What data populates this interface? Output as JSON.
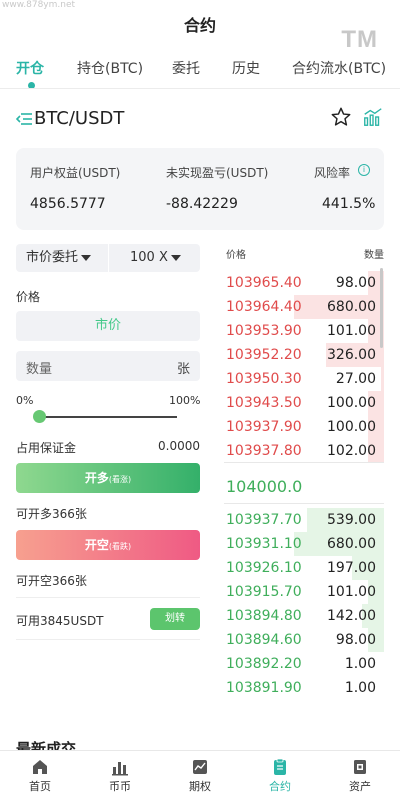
{
  "watermark": "www.878ym.net",
  "tm_mark": "TM",
  "header": {
    "title": "合约"
  },
  "tabs": [
    {
      "label": "开仓",
      "active": true
    },
    {
      "label": "持仓(BTC)"
    },
    {
      "label": "委托"
    },
    {
      "label": "历史"
    },
    {
      "label": "合约流水(BTC)"
    }
  ],
  "pair": {
    "name": "BTC/USDT",
    "icons": [
      "menu-fold-icon",
      "star-icon",
      "chart-icon"
    ]
  },
  "account": {
    "equity_label": "用户权益(USDT)",
    "equity_value": "4856.5777",
    "pnl_label": "未实现盈亏(USDT)",
    "pnl_value": "-88.42229",
    "risk_label": "风险率",
    "risk_value": "441.5%"
  },
  "order_form": {
    "order_type": "市价委托",
    "leverage": "100 X",
    "price_label": "价格",
    "market_text": "市价",
    "quantity_placeholder": "数量",
    "quantity_unit": "张",
    "percent_min": "0%",
    "percent_max": "100%",
    "slider_percent": 0,
    "margin_label": "占用保证金",
    "margin_value": "0.0000",
    "long_button": "开多",
    "long_button_sub": "(看涨)",
    "can_long": "可开多366张",
    "short_button": "开空",
    "short_button_sub": "(看跌)",
    "can_short": "可开空366张",
    "available": "可用3845USDT",
    "transfer_button": "划转"
  },
  "order_book": {
    "price_header": "价格",
    "qty_header": "数量",
    "asks": [
      {
        "price": "103965.40",
        "qty": "98.00",
        "depth": 0.1
      },
      {
        "price": "103964.40",
        "qty": "680.00",
        "depth": 0.56
      },
      {
        "price": "103953.90",
        "qty": "101.00",
        "depth": 0.1
      },
      {
        "price": "103952.20",
        "qty": "326.00",
        "depth": 0.36
      },
      {
        "price": "103950.30",
        "qty": "27.00",
        "depth": 0.02
      },
      {
        "price": "103943.50",
        "qty": "100.00",
        "depth": 0.1
      },
      {
        "price": "103937.90",
        "qty": "100.00",
        "depth": 0.1
      },
      {
        "price": "103937.80",
        "qty": "102.00",
        "depth": 0.1
      }
    ],
    "last_price": "104000.0",
    "bids": [
      {
        "price": "103937.70",
        "qty": "539.00",
        "depth": 0.48
      },
      {
        "price": "103931.10",
        "qty": "680.00",
        "depth": 0.56
      },
      {
        "price": "103926.10",
        "qty": "197.00",
        "depth": 0.2
      },
      {
        "price": "103915.70",
        "qty": "101.00",
        "depth": 0.1
      },
      {
        "price": "103894.80",
        "qty": "142.00",
        "depth": 0.14
      },
      {
        "price": "103894.60",
        "qty": "98.00",
        "depth": 0.1
      },
      {
        "price": "103892.20",
        "qty": "1.00",
        "depth": 0.0
      },
      {
        "price": "103891.90",
        "qty": "1.00",
        "depth": 0.0
      }
    ]
  },
  "recent_trades_title": "最新成交",
  "bottom_nav": [
    {
      "label": "首页",
      "icon": "home-icon"
    },
    {
      "label": "币币",
      "icon": "bar-chart-icon"
    },
    {
      "label": "期权",
      "icon": "option-icon"
    },
    {
      "label": "合约",
      "icon": "contract-icon",
      "active": true
    },
    {
      "label": "资产",
      "icon": "asset-icon"
    }
  ],
  "colors": {
    "accent": "#2bb5a7",
    "up": "#3fae5b",
    "down": "#e04b4b"
  }
}
